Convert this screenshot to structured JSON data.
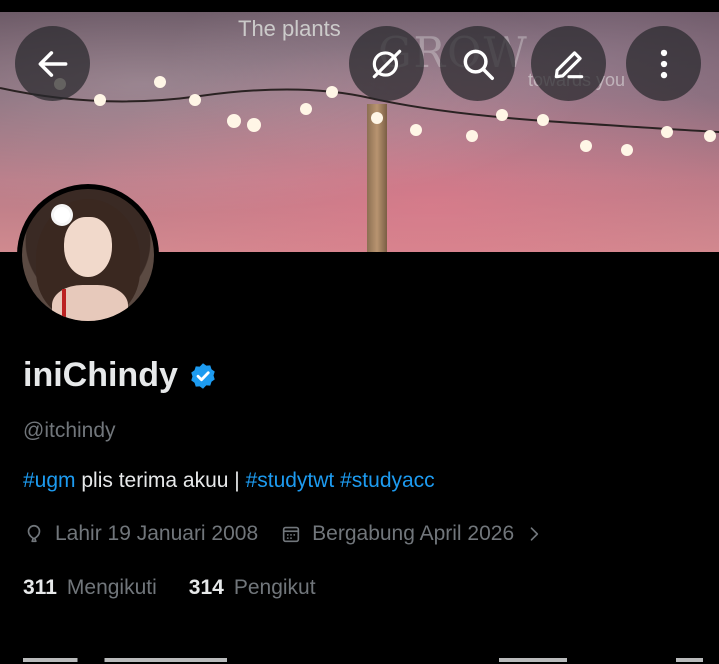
{
  "header": {
    "banner_text": [
      "The plants",
      "GROW",
      "towards you"
    ],
    "buttons": {
      "back": "back-arrow-icon",
      "grok": "grok-icon",
      "search": "search-icon",
      "edit": "edit-icon",
      "more": "more-icon"
    }
  },
  "profile": {
    "name": "iniChindy",
    "handle": "@itchindy",
    "verified": true,
    "bio": {
      "tag1": "#ugm",
      "text": " plis terima akuu | ",
      "tag2": "#studytwt",
      "tag3": "#studyacc"
    },
    "birth": "Lahir 19 Januari 2008",
    "joined": "Bergabung April 2026",
    "following_count": "311",
    "following_label": "Mengikuti",
    "followers_count": "314",
    "followers_label": "Pengikut"
  },
  "colors": {
    "accent": "#1d9bf0",
    "muted": "#71767b",
    "text": "#e7e9ea",
    "background": "#000000"
  }
}
